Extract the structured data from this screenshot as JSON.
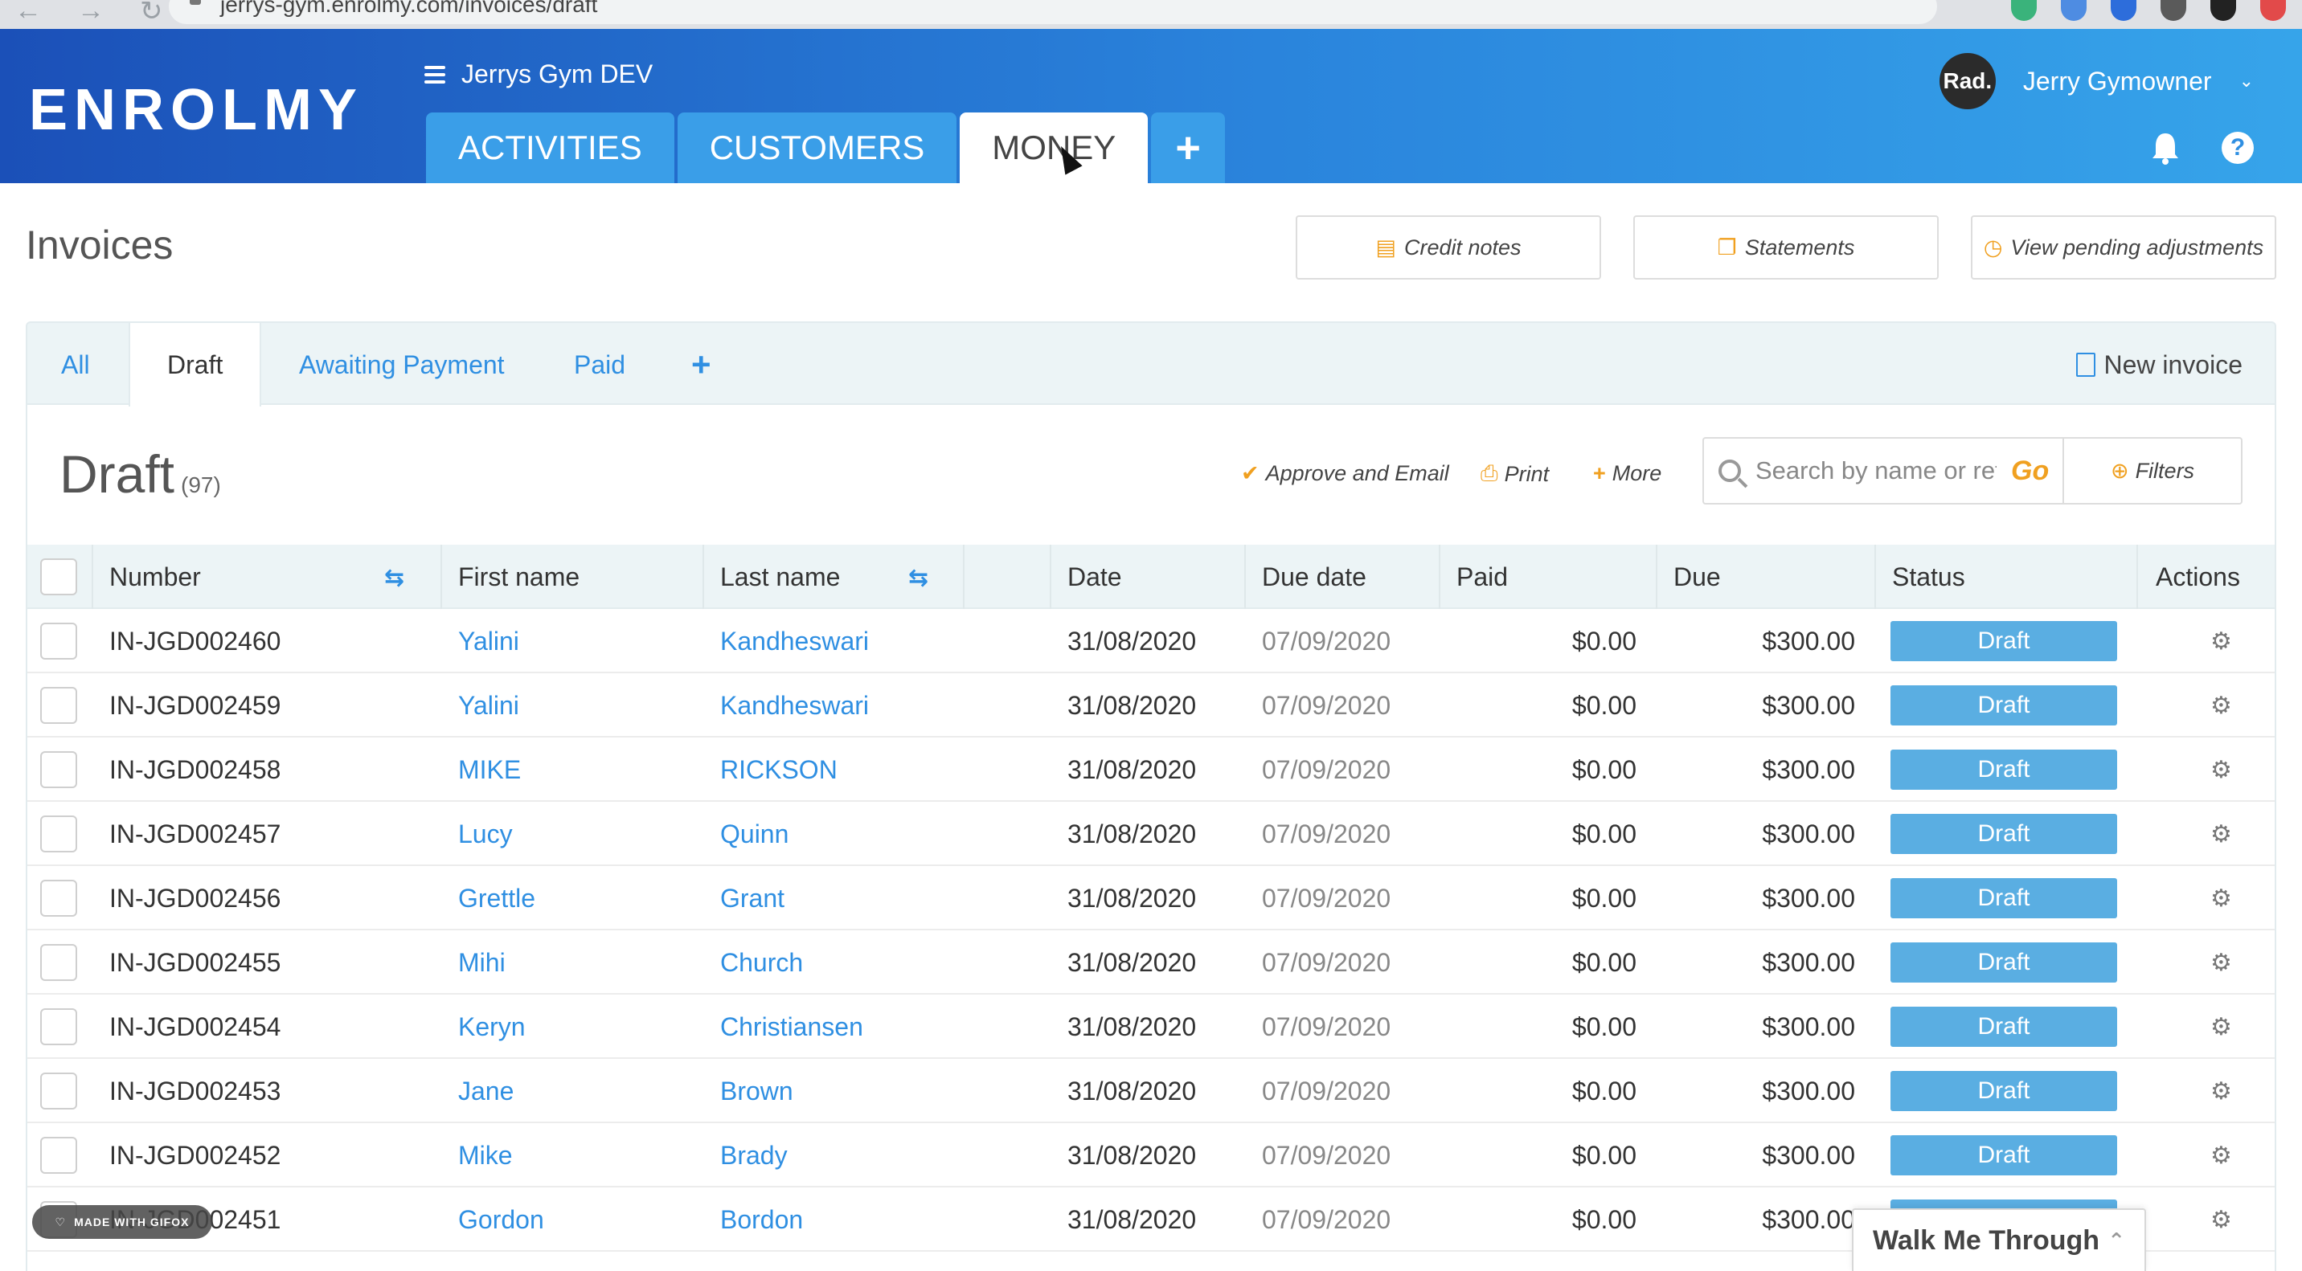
{
  "browser": {
    "url": "jerrys-gym.enrolmy.com/invoices/draft"
  },
  "header": {
    "logo": "ENROLMY",
    "org_name": "Jerrys Gym DEV",
    "tabs": [
      {
        "label": "ACTIVITIES"
      },
      {
        "label": "CUSTOMERS"
      },
      {
        "label": "MONEY"
      }
    ],
    "plus": "+",
    "avatar_text": "Rad.",
    "user_name": "Jerry Gymowner",
    "help": "?"
  },
  "page": {
    "title": "Invoices",
    "buttons": {
      "credit_notes": "Credit notes",
      "statements": "Statements",
      "pending": "View pending adjustments"
    }
  },
  "subtabs": {
    "items": [
      {
        "label": "All"
      },
      {
        "label": "Draft"
      },
      {
        "label": "Awaiting Payment"
      },
      {
        "label": "Paid"
      }
    ],
    "plus": "+",
    "new_invoice": "New invoice"
  },
  "list": {
    "title": "Draft",
    "count": "(97)",
    "approve": "Approve and Email",
    "print": "Print",
    "more": "More",
    "search_placeholder": "Search by name or ref",
    "go": "Go",
    "filters": "Filters"
  },
  "table": {
    "headers": {
      "number": "Number",
      "first_name": "First name",
      "last_name": "Last name",
      "date": "Date",
      "due_date": "Due date",
      "paid": "Paid",
      "due": "Due",
      "status": "Status",
      "actions": "Actions"
    },
    "rows": [
      {
        "number": "IN-JGD002460",
        "first": "Yalini",
        "last": "Kandheswari",
        "date": "31/08/2020",
        "due_date": "07/09/2020",
        "paid": "$0.00",
        "due": "$300.00",
        "status": "Draft"
      },
      {
        "number": "IN-JGD002459",
        "first": "Yalini",
        "last": "Kandheswari",
        "date": "31/08/2020",
        "due_date": "07/09/2020",
        "paid": "$0.00",
        "due": "$300.00",
        "status": "Draft"
      },
      {
        "number": "IN-JGD002458",
        "first": "MIKE",
        "last": "RICKSON",
        "date": "31/08/2020",
        "due_date": "07/09/2020",
        "paid": "$0.00",
        "due": "$300.00",
        "status": "Draft"
      },
      {
        "number": "IN-JGD002457",
        "first": "Lucy",
        "last": "Quinn",
        "date": "31/08/2020",
        "due_date": "07/09/2020",
        "paid": "$0.00",
        "due": "$300.00",
        "status": "Draft"
      },
      {
        "number": "IN-JGD002456",
        "first": "Grettle",
        "last": "Grant",
        "date": "31/08/2020",
        "due_date": "07/09/2020",
        "paid": "$0.00",
        "due": "$300.00",
        "status": "Draft"
      },
      {
        "number": "IN-JGD002455",
        "first": "Mihi",
        "last": "Church",
        "date": "31/08/2020",
        "due_date": "07/09/2020",
        "paid": "$0.00",
        "due": "$300.00",
        "status": "Draft"
      },
      {
        "number": "IN-JGD002454",
        "first": "Keryn",
        "last": "Christiansen",
        "date": "31/08/2020",
        "due_date": "07/09/2020",
        "paid": "$0.00",
        "due": "$300.00",
        "status": "Draft"
      },
      {
        "number": "IN-JGD002453",
        "first": "Jane",
        "last": "Brown",
        "date": "31/08/2020",
        "due_date": "07/09/2020",
        "paid": "$0.00",
        "due": "$300.00",
        "status": "Draft"
      },
      {
        "number": "IN-JGD002452",
        "first": "Mike",
        "last": "Brady",
        "date": "31/08/2020",
        "due_date": "07/09/2020",
        "paid": "$0.00",
        "due": "$300.00",
        "status": "Draft"
      },
      {
        "number": "IN-JGD002451",
        "first": "Gordon",
        "last": "Bordon",
        "date": "31/08/2020",
        "due_date": "07/09/2020",
        "paid": "$0.00",
        "due": "$300.00",
        "status": "Draft"
      }
    ]
  },
  "overlays": {
    "gifox": "MADE WITH GIFOX",
    "walk_me": "Walk Me Through"
  },
  "colors": {
    "accent": "#2f8fe2",
    "status_draft": "#5aaee2",
    "orange": "#f0a020"
  }
}
